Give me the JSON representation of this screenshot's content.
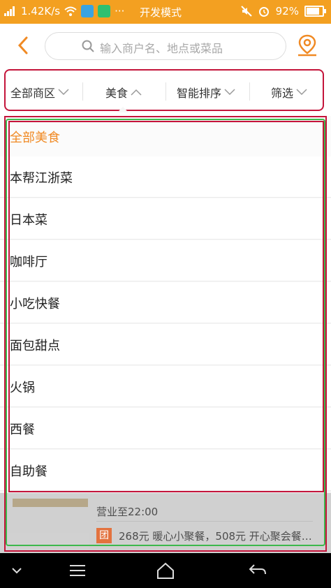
{
  "status": {
    "speed": "1.42K/s",
    "mode": "开发模式",
    "battery": "92%",
    "net": "4G"
  },
  "header": {
    "search_placeholder": "输入商户名、地点或菜品",
    "icons": {
      "back": "back-arrow-icon",
      "search": "search-icon",
      "map": "map-pin-icon"
    }
  },
  "filters": [
    {
      "label": "全部商区",
      "expanded": false
    },
    {
      "label": "美食",
      "expanded": true
    },
    {
      "label": "智能排序",
      "expanded": false
    },
    {
      "label": "筛选",
      "expanded": false
    }
  ],
  "categories": [
    {
      "label": "全部美食",
      "selected": true
    },
    {
      "label": "本帮江浙菜"
    },
    {
      "label": "日本菜"
    },
    {
      "label": "咖啡厅"
    },
    {
      "label": "小吃快餐"
    },
    {
      "label": "面包甜点"
    },
    {
      "label": "火锅"
    },
    {
      "label": "西餐"
    },
    {
      "label": "自助餐"
    }
  ],
  "background_listing": {
    "hours": "营业至22:00",
    "deal_badge": "团",
    "deal_text": "268元 暖心小聚餐，508元 开心聚会餐…"
  },
  "colors": {
    "status_bar": "#f3a021",
    "accent": "#f08a24",
    "highlight_red": "#c4143a",
    "highlight_green": "#3cb84c"
  }
}
